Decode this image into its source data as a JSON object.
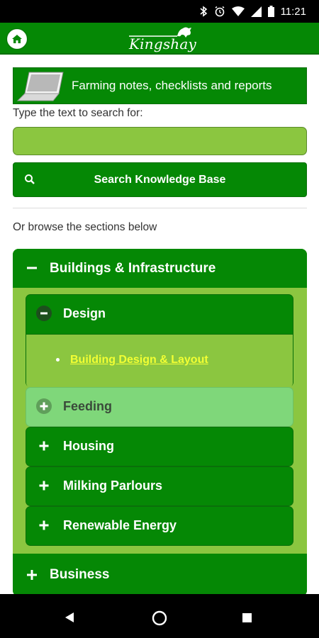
{
  "status_bar": {
    "time": "11:21",
    "icons": [
      "bluetooth-icon",
      "alarm-icon",
      "wifi-icon",
      "signal-icon",
      "battery-icon"
    ]
  },
  "header": {
    "logo_text": "Kingshay",
    "home_icon": "home-icon"
  },
  "banner": {
    "label": "Farming notes, checklists and reports",
    "icon": "laptop-icon"
  },
  "search": {
    "hint": "Type the text to search for:",
    "value": "",
    "placeholder": "",
    "button_label": "Search Knowledge Base",
    "button_icon": "search-icon"
  },
  "browse_hint": "Or browse the sections below",
  "sections": [
    {
      "label": "Buildings & Infrastructure",
      "expanded": true,
      "subsections": [
        {
          "label": "Design",
          "expanded": true,
          "links": [
            "Building Design & Layout"
          ]
        },
        {
          "label": "Feeding",
          "expanded": false,
          "hover": true
        },
        {
          "label": "Housing",
          "expanded": false
        },
        {
          "label": "Milking Parlours",
          "expanded": false
        },
        {
          "label": "Renewable Energy",
          "expanded": false
        }
      ]
    },
    {
      "label": "Business",
      "expanded": false
    }
  ],
  "colors": {
    "primary_green": "#058805",
    "light_green": "#8bc640",
    "hover_green": "#7fd77a",
    "link_yellow": "#f2ff33"
  },
  "navigation_bar": [
    "back-icon",
    "home-circle-icon",
    "overview-icon"
  ]
}
